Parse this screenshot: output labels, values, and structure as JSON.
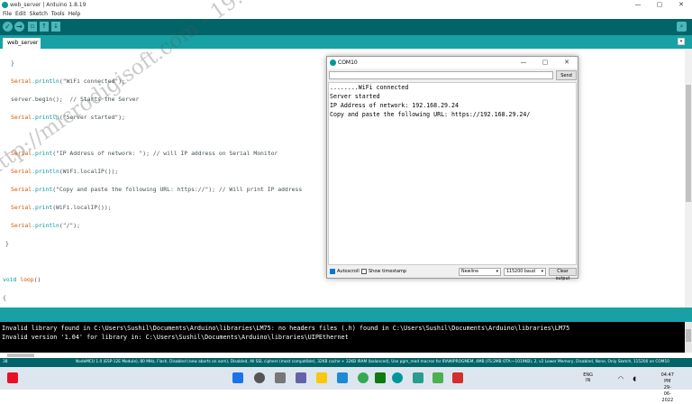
{
  "window": {
    "title": "web_server | Arduino 1.8.19",
    "min": "—",
    "max": "▢",
    "close": "✕"
  },
  "menu": [
    "File",
    "Edit",
    "Sketch",
    "Tools",
    "Help"
  ],
  "toolbar": {
    "verify": "✓",
    "upload": "→",
    "new": "▫",
    "open": "↑",
    "save": "↓",
    "serial_monitor": "⌕"
  },
  "tabs": [
    {
      "label": "web_server"
    }
  ],
  "tab_menu": "▾",
  "code": {
    "l1": "}",
    "l2_obj": "Serial",
    "l2_fn": ".println",
    "l2_str": "(\"WiFi connected\");",
    "l3": "server.begin();  // Starts the Server",
    "l4_obj": "Serial",
    "l4_fn": ".println",
    "l4_str": "(\"Server started\");",
    "l5_obj": "Serial",
    "l5_fn": ".print",
    "l5_rest": "(\"IP Address of network: \"); // will IP address on Serial Monitor",
    "l6_obj": "Serial",
    "l6_fn": ".println",
    "l6_rest": "(WiFi.localIP());",
    "l7_obj": "Serial",
    "l7_fn": ".print",
    "l7_rest": "(\"Copy and paste the following URL: https://\"); // Will print IP address",
    "l8_obj": "Serial",
    "l8_fn": ".print",
    "l8_rest": "(WiFi.localIP());",
    "l9_obj": "Serial",
    "l9_fn": ".println",
    "l9_rest": "(\"/\");",
    "l10": "}",
    "l11_kw": "void",
    "l11_fn": " loop",
    "l11_rest": "()",
    "l12": "{"
  },
  "console": [
    "Invalid library found in C:\\Users\\Sushil\\Documents\\Arduino\\libraries\\LM75: no headers files (.h) found in C:\\Users\\Sushil\\Documents\\Arduino\\libraries\\LM75",
    "Invalid version '1.04' for library in: C:\\Users\\Sushil\\Documents\\Arduino\\libraries\\UIPEthernet"
  ],
  "status": {
    "line": "38",
    "board": "NodeMCU 1.0 (ESP-12E Module), 80 MHz, Flash, Disabled (new aborts on oom), Disabled, All SSL ciphers (most compatible), 32KB cache + 32KB IRAM (balanced), Use pgm_read macros for IRAM/PROGMEM, 4MB (FS:2MB OTA:~1019KB), 2, v2 Lower Memory, Disabled, None, Only Sketch, 115200 on COM10"
  },
  "serial": {
    "title": "COM10",
    "input_value": "",
    "send": "Send",
    "output": [
      "........WiFi connected",
      "Server started",
      "IP Address of network: 192.168.29.24",
      "Copy and paste the following URL: https://192.168.29.24/"
    ],
    "autoscroll": "Autoscroll",
    "timestamp": "Show timestamp",
    "line_ending": "Newline",
    "baud": "115200 baud",
    "clear": "Clear output"
  },
  "watermark": "http://microdigisoft.com - 19:04",
  "taskbar": {
    "lang1": "ENG",
    "lang2": "IN",
    "time": "04:47 PM",
    "date": "29-06-2022"
  },
  "colors": {
    "toolbar": "#006468",
    "tabrow": "#17a1a5",
    "accent": "#00979c"
  }
}
